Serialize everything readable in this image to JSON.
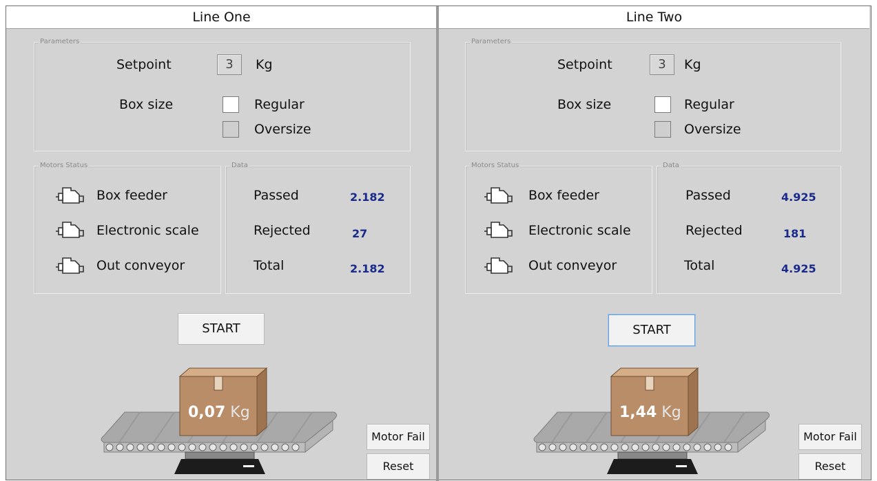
{
  "lines": [
    {
      "title": "Line One",
      "parameters_label": "Parameters",
      "setpoint_label": "Setpoint",
      "setpoint_value": "3",
      "setpoint_unit": "Kg",
      "boxsize_label": "Box size",
      "regular_label": "Regular",
      "regular_checked": true,
      "oversize_label": "Oversize",
      "oversize_checked": false,
      "motors_label": "Motors Status",
      "motors": [
        "Box feeder",
        "Electronic scale",
        "Out conveyor"
      ],
      "data_label": "Data",
      "stats": [
        {
          "label": "Passed",
          "value": "2.182"
        },
        {
          "label": "Rejected",
          "value": "27"
        },
        {
          "label": "Total",
          "value": "2.182"
        }
      ],
      "start_label": "START",
      "weight_value": "0,07",
      "weight_unit": "Kg",
      "motor_fail_label": "Motor Fail",
      "reset_label": "Reset"
    },
    {
      "title": "Line Two",
      "parameters_label": "Parameters",
      "setpoint_label": "Setpoint",
      "setpoint_value": "3",
      "setpoint_unit": "Kg",
      "boxsize_label": "Box size",
      "regular_label": "Regular",
      "regular_checked": true,
      "oversize_label": "Oversize",
      "oversize_checked": false,
      "motors_label": "Motors Status",
      "motors": [
        "Box feeder",
        "Electronic scale",
        "Out conveyor"
      ],
      "data_label": "Data",
      "stats": [
        {
          "label": "Passed",
          "value": "4.925"
        },
        {
          "label": "Rejected",
          "value": "181"
        },
        {
          "label": "Total",
          "value": "4.925"
        }
      ],
      "start_label": "START",
      "weight_value": "1,44",
      "weight_unit": "Kg",
      "motor_fail_label": "Motor Fail",
      "reset_label": "Reset"
    }
  ],
  "colors": {
    "panel_bg": "#d3d3d3",
    "value_text": "#1a2a8a",
    "box_fill": "#b98d67",
    "belt": "#a9a9a9",
    "scale_base": "#1c1c1c"
  },
  "icons": {
    "motor": "motor-icon",
    "box": "cardboard-box-icon",
    "conveyor": "conveyor-belt-icon"
  }
}
